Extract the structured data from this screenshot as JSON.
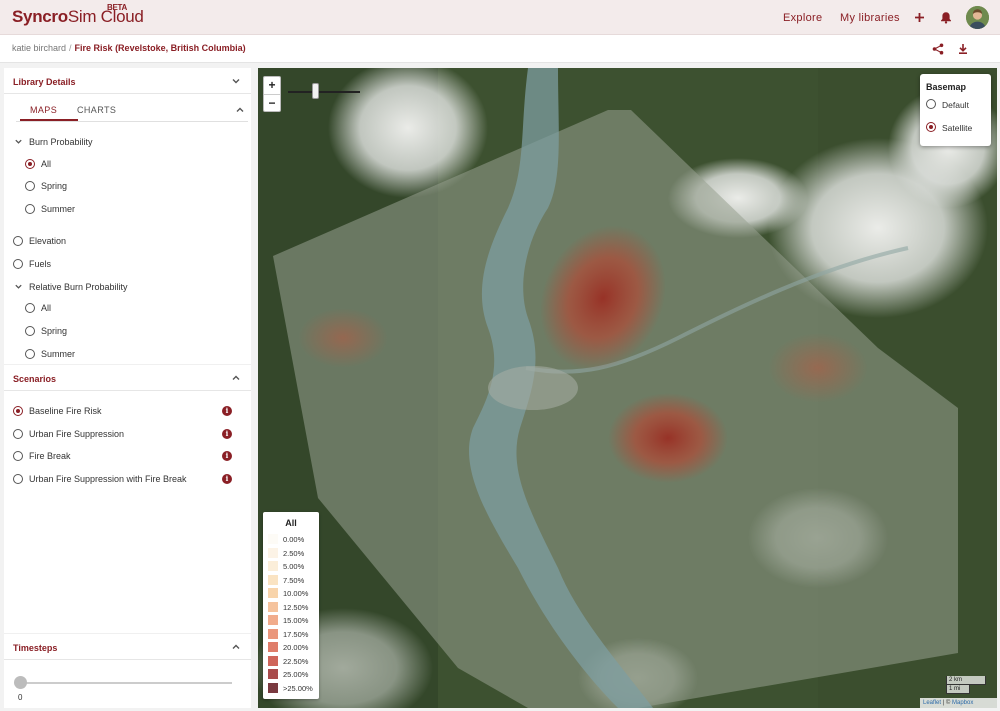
{
  "header": {
    "logo_bold": "Syncro",
    "logo_rest": "Sim Cloud",
    "beta": "BETA",
    "explore": "Explore",
    "my_libraries": "My libraries"
  },
  "breadcrumb": {
    "user": "katie birchard",
    "separator": "/",
    "project": "Fire Risk (Revelstoke, British Columbia)"
  },
  "library_details": {
    "title": "Library Details"
  },
  "tabs": {
    "maps": "MAPS",
    "charts": "CHARTS"
  },
  "maps": {
    "burn_probability": {
      "label": "Burn Probability",
      "options": [
        "All",
        "Spring",
        "Summer"
      ],
      "selected": "All"
    },
    "elevation": "Elevation",
    "fuels": "Fuels",
    "relative_burn_probability": {
      "label": "Relative Burn Probability",
      "options": [
        "All",
        "Spring",
        "Summer"
      ]
    }
  },
  "scenarios": {
    "title": "Scenarios",
    "items": [
      "Baseline Fire Risk",
      "Urban Fire Suppression",
      "Fire Break",
      "Urban Fire Suppression with Fire Break"
    ],
    "selected": "Baseline Fire Risk",
    "info_glyph": "i"
  },
  "timesteps": {
    "title": "Timesteps",
    "value": "0"
  },
  "map": {
    "zoom_in": "+",
    "zoom_out": "−",
    "basemap": {
      "title": "Basemap",
      "options": [
        "Default",
        "Satellite"
      ],
      "selected": "Satellite"
    },
    "legend": {
      "title": "All",
      "items": [
        {
          "label": "0.00%",
          "color": "#fdfbf6"
        },
        {
          "label": "2.50%",
          "color": "#fcf3e6"
        },
        {
          "label": "5.00%",
          "color": "#fbeed9"
        },
        {
          "label": "7.50%",
          "color": "#fae3c2"
        },
        {
          "label": "10.00%",
          "color": "#f8d4ab"
        },
        {
          "label": "12.50%",
          "color": "#f5c39d"
        },
        {
          "label": "15.00%",
          "color": "#f1ac8c"
        },
        {
          "label": "17.50%",
          "color": "#ea977c"
        },
        {
          "label": "20.00%",
          "color": "#df7d6a"
        },
        {
          "label": "22.50%",
          "color": "#cf665b"
        },
        {
          "label": "25.00%",
          "color": "#a94c4c"
        },
        {
          "label": ">25.00%",
          "color": "#7a3a40"
        }
      ]
    },
    "scale": {
      "km": "2 km",
      "mi": "1 mi"
    },
    "attribution": {
      "leaflet": "Leaflet",
      "sep": " | © ",
      "mapbox": "Mapbox"
    }
  },
  "colors": {
    "brand": "#8a1f25",
    "header_bg": "#f3ebeb"
  }
}
